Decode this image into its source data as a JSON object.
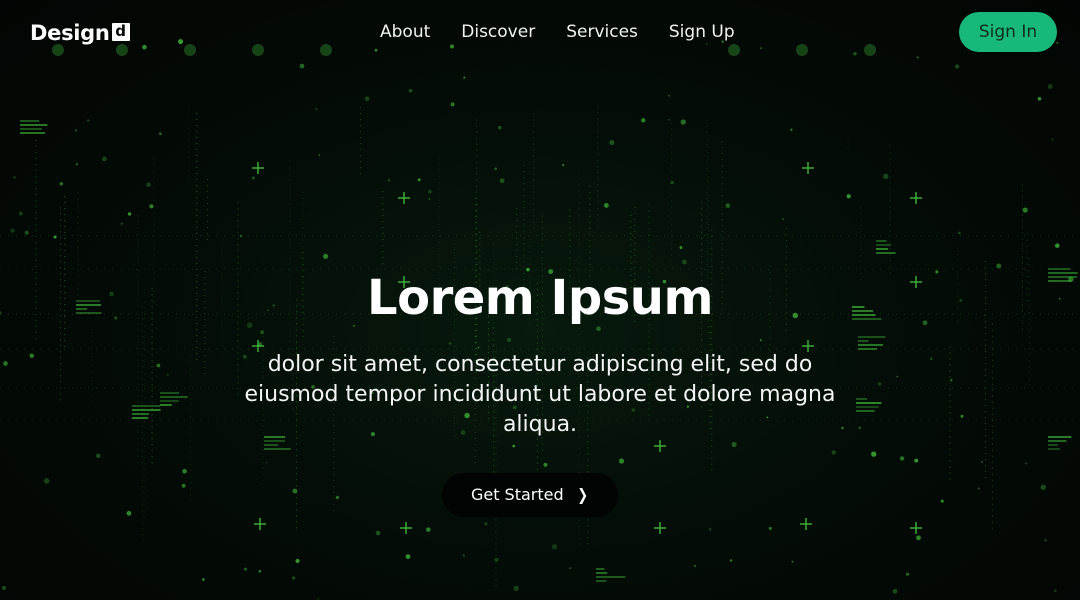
{
  "brand": {
    "name": "Design",
    "badge": "d"
  },
  "nav": {
    "items": [
      {
        "label": "About"
      },
      {
        "label": "Discover"
      },
      {
        "label": "Services"
      },
      {
        "label": "Sign Up"
      }
    ]
  },
  "signin_label": "Sign In",
  "hero": {
    "title": "Lorem Ipsum",
    "subtitle": "dolor sit amet, consectetur adipiscing elit, sed do eiusmod tempor incididunt ut labore et dolore magna aliqua.",
    "cta_label": "Get Started",
    "cta_icon": "chevron-right-icon"
  },
  "colors": {
    "accent": "#17b879",
    "background": "#020705",
    "particles": "#3fb53a"
  }
}
